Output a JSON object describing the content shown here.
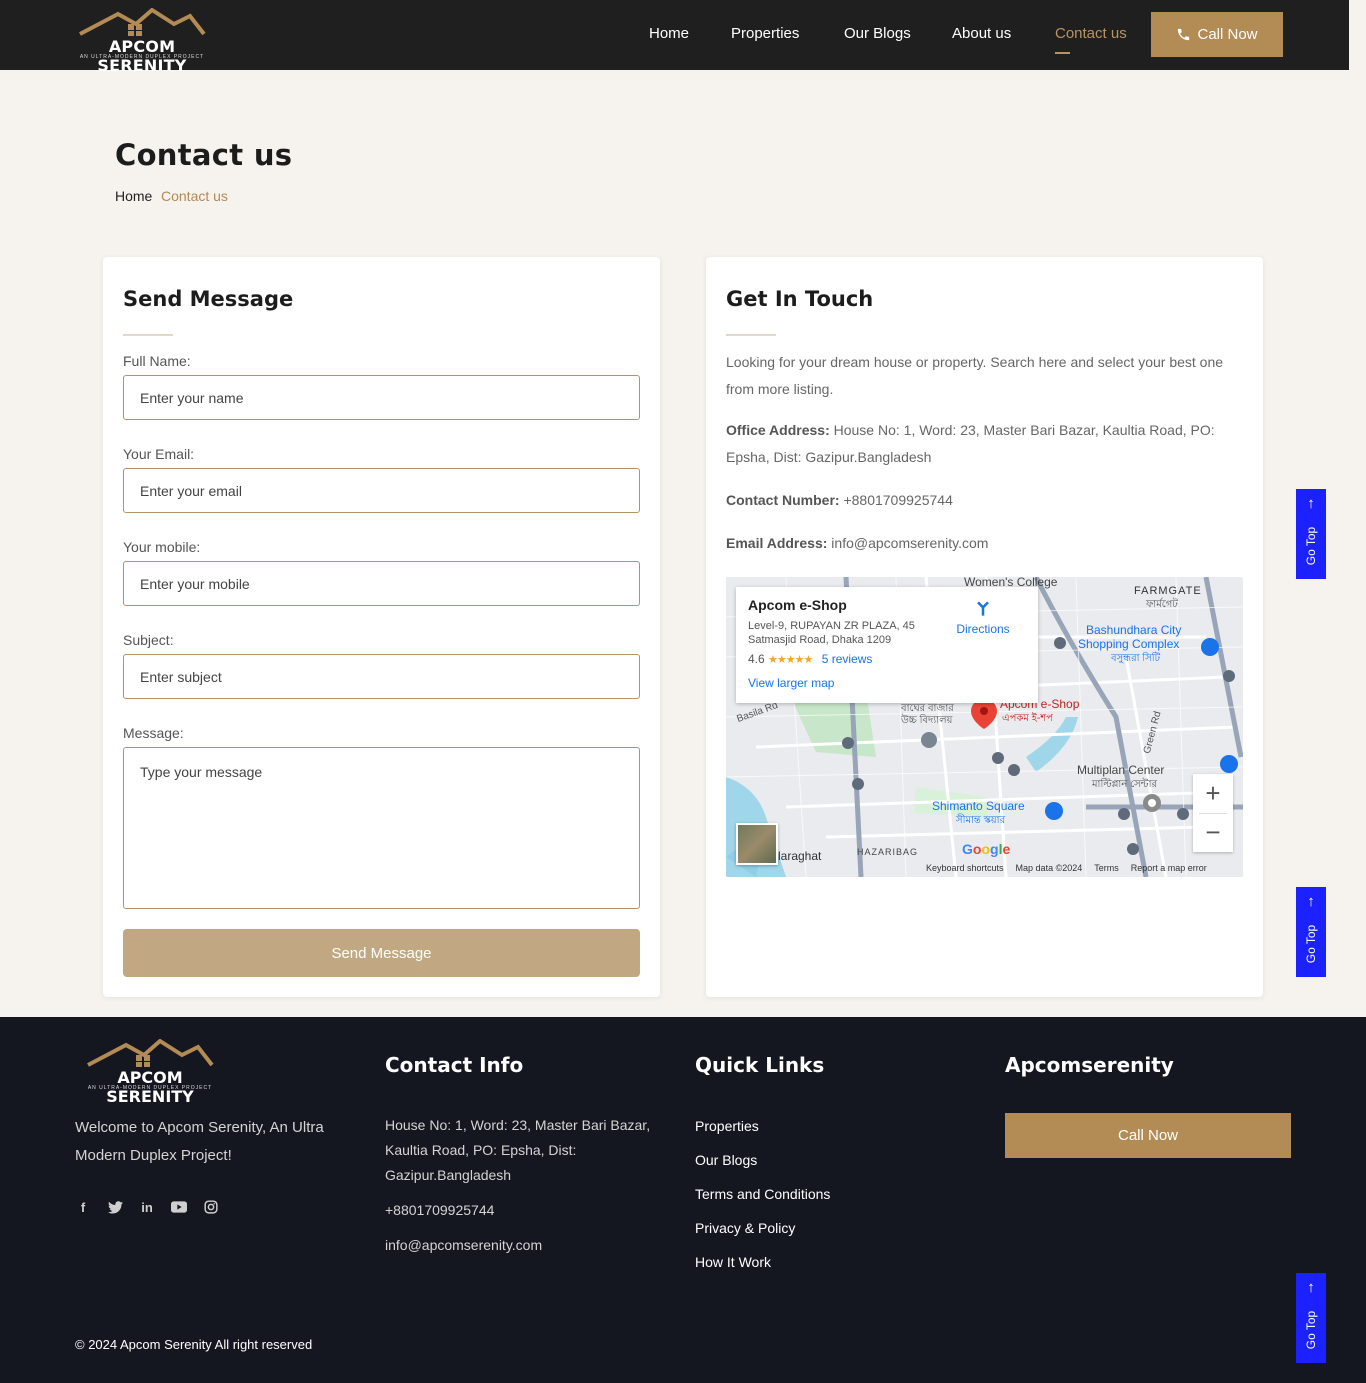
{
  "brand": {
    "name": "APCOM SERENITY",
    "tagline": "AN ULTRA-MODERN DUPLEX PROJECT"
  },
  "nav": {
    "items": [
      "Home",
      "Properties",
      "Our Blogs",
      "About us",
      "Contact us"
    ],
    "active": "Contact us",
    "call_label": "Call Now"
  },
  "page": {
    "title": "Contact us",
    "breadcrumb": [
      "Home",
      "Contact us"
    ]
  },
  "form": {
    "heading": "Send Message",
    "fields": [
      {
        "label": "Full Name:",
        "placeholder": "Enter your name"
      },
      {
        "label": "Your Email:",
        "placeholder": "Enter your email"
      },
      {
        "label": "Your mobile:",
        "placeholder": "Enter your mobile"
      },
      {
        "label": "Subject:",
        "placeholder": "Enter subject"
      },
      {
        "label": "Message:",
        "placeholder": "Type your message"
      }
    ],
    "submit_label": "Send Message"
  },
  "contact": {
    "heading": "Get In Touch",
    "intro": "Looking for your dream house or property. Search here and select your best one from more listing.",
    "office_label": "Office Address:",
    "office_value": "House No: 1, Word: 23, Master Bari Bazar, Kaultia Road, PO: Epsha, Dist: Gazipur.Bangladesh",
    "phone_label": "Contact Number:",
    "phone_value": "+8801709925744",
    "email_label": "Email Address:",
    "email_value": "info@apcomserenity.com"
  },
  "map": {
    "place_name": "Apcom e-Shop",
    "place_address": "Level-9, RUPAYAN ZR PLAZA, 45 Satmasjid Road, Dhaka 1209",
    "rating": "4.6",
    "stars": "★★★★★",
    "reviews": "5 reviews",
    "directions": "Directions",
    "view_larger": "View larger map",
    "labels": [
      "Women's College",
      "FARMGATE",
      "ফার্মগেট",
      "Bashundhara City",
      "Shopping Complex",
      "বসুন্ধরা সিটি",
      "Apcom e-Shop",
      "এপকম ই-শপ",
      "Multiplan Center",
      "মাল্টিপ্লান সেন্টার",
      "Shimanto Square",
      "সীমান্ত স্কয়ার",
      "HAZARIBAG",
      "Basila Rd",
      "Green Rd",
      "laraghat",
      "বাঘের বাজার",
      "উচ্চ বিদ্যালয়"
    ],
    "footer_items": [
      "Keyboard shortcuts",
      "Map data ©2024",
      "Terms",
      "Report a map error"
    ],
    "google": "Google"
  },
  "footer": {
    "welcome": "Welcome to Apcom Serenity, An Ultra Modern Duplex Project!",
    "social_icons": [
      "facebook-icon",
      "twitter-icon",
      "linkedin-icon",
      "youtube-icon",
      "instagram-icon"
    ],
    "contact_heading": "Contact Info",
    "contact_address": "House No: 1, Word: 23, Master Bari Bazar, Kaultia Road, PO: Epsha, Dist: Gazipur.Bangladesh",
    "contact_phone": "+8801709925744",
    "contact_email": "info@apcomserenity.com",
    "links_heading": "Quick Links",
    "links": [
      "Properties",
      "Our Blogs",
      "Terms and Conditions",
      "Privacy & Policy",
      "How It Work"
    ],
    "brand_heading": "Apcomserenity",
    "call_label": "Call Now",
    "copyright": "© 2024 Apcom Serenity All right reserved"
  },
  "go_top": {
    "label": "Go Top",
    "arrow": "↑"
  },
  "colors": {
    "accent": "#b38c55",
    "dark": "#1f1f1f",
    "footer": "#141720",
    "go_top": "#1b22ff"
  }
}
